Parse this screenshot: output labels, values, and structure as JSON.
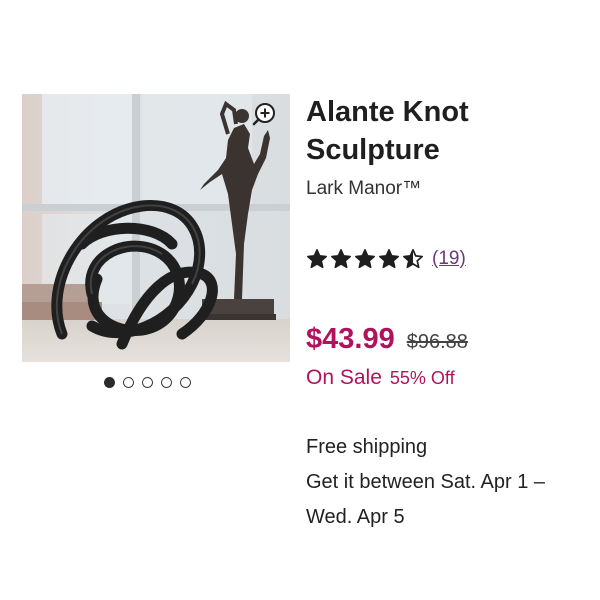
{
  "product": {
    "title": "Alante Knot Sculpture",
    "brand": "Lark Manor™",
    "rating": 4.5,
    "rating_max": 5,
    "review_count": "(19)"
  },
  "gallery": {
    "image_count": 5,
    "active_index": 0,
    "zoom_icon": "zoom-in-icon"
  },
  "pricing": {
    "sale_price": "$43.99",
    "original_price": "$96.88",
    "sale_label": "On Sale",
    "discount": "55% Off"
  },
  "shipping": {
    "line1": "Free shipping",
    "line2": "Get it between Sat. Apr 1 –",
    "line3": "Wed. Apr 5"
  },
  "colors": {
    "sale": "#b0135c",
    "review_link": "#6b3a76",
    "star": "#1e1e1e"
  }
}
